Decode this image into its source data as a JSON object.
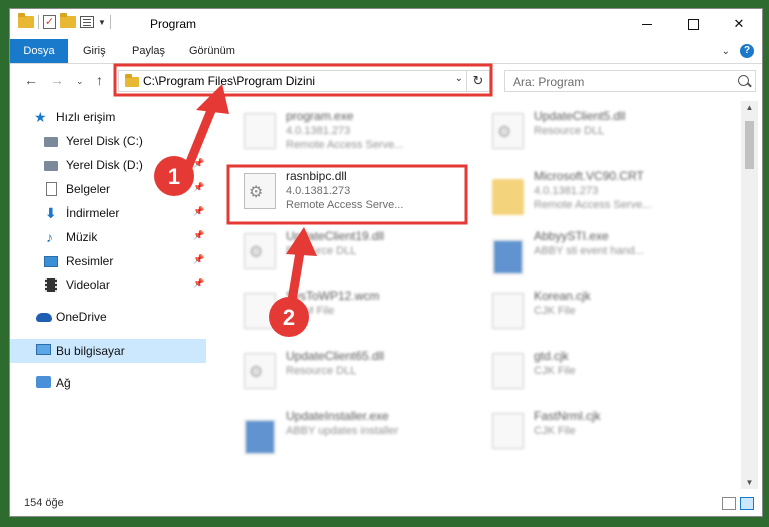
{
  "window": {
    "title": "Program"
  },
  "ribbon": {
    "tabs": [
      "Dosya",
      "Giriş",
      "Paylaş",
      "Görünüm"
    ],
    "help": "?"
  },
  "nav": {
    "address": "C:\\Program Files\\Program Dizini",
    "search_placeholder": "Ara: Program"
  },
  "sidebar": {
    "items": [
      {
        "label": "Hızlı erişim",
        "icon": "star-icon"
      },
      {
        "label": "Yerel Disk (C:)",
        "icon": "disk-icon",
        "pinned": true
      },
      {
        "label": "Yerel Disk (D:)",
        "icon": "disk-icon",
        "pinned": true
      },
      {
        "label": "Belgeler",
        "icon": "document-icon",
        "pinned": true
      },
      {
        "label": "İndirmeler",
        "icon": "download-icon",
        "pinned": true
      },
      {
        "label": "Müzik",
        "icon": "music-icon",
        "pinned": true
      },
      {
        "label": "Resimler",
        "icon": "pictures-icon",
        "pinned": true
      },
      {
        "label": "Videolar",
        "icon": "videos-icon",
        "pinned": true
      },
      {
        "label": "OneDrive",
        "icon": "cloud-icon"
      },
      {
        "label": "Bu bilgisayar",
        "icon": "computer-icon",
        "selected": true
      },
      {
        "label": "Ağ",
        "icon": "network-icon"
      }
    ]
  },
  "files": [
    {
      "name": "program.exe",
      "line2": "4.0.1381.273",
      "line3": "Remote Access Serve...",
      "icon": "exe-icon",
      "blurred": true
    },
    {
      "name": "UpdateClient5.dll",
      "line2": "Resource DLL",
      "line3": "",
      "icon": "dll-icon",
      "blurred": true
    },
    {
      "name": "rasnbipc.dll",
      "line2": "4.0.1381.273",
      "line3": "Remote Access Serve...",
      "icon": "dll-gear-icon",
      "blurred": false
    },
    {
      "name": "Microsoft.VC90.CRT",
      "line2": "4.0.1381.273",
      "line3": "Remote Access Serve...",
      "icon": "folder-icon",
      "blurred": true
    },
    {
      "name": "UpdateClient19.dll",
      "line2": "Resource DLL",
      "line3": "",
      "icon": "dll-icon",
      "blurred": true
    },
    {
      "name": "AbbyySTI.exe",
      "line2": "ABBY sti event hand...",
      "line3": "",
      "icon": "app-icon",
      "blurred": true
    },
    {
      "name": "SysToWP12.wcm",
      "line2": "WCM File",
      "line3": "",
      "icon": "file-icon",
      "blurred": true
    },
    {
      "name": "Korean.cjk",
      "line2": "CJK File",
      "line3": "",
      "icon": "file-icon",
      "blurred": true
    },
    {
      "name": "UpdateClient65.dll",
      "line2": "Resource DLL",
      "line3": "",
      "icon": "dll-icon",
      "blurred": true
    },
    {
      "name": "gtd.cjk",
      "line2": "CJK File",
      "line3": "",
      "icon": "file-icon",
      "blurred": true
    },
    {
      "name": "UpdateInstaller.exe",
      "line2": "ABBY updates installer",
      "line3": "",
      "icon": "app-icon",
      "blurred": true
    },
    {
      "name": "FastNrml.cjk",
      "line2": "CJK File",
      "line3": "",
      "icon": "file-icon",
      "blurred": true
    }
  ],
  "status": {
    "count": "154 öğe"
  },
  "annotations": {
    "badge1": "1",
    "badge2": "2",
    "color": "#e53935"
  }
}
